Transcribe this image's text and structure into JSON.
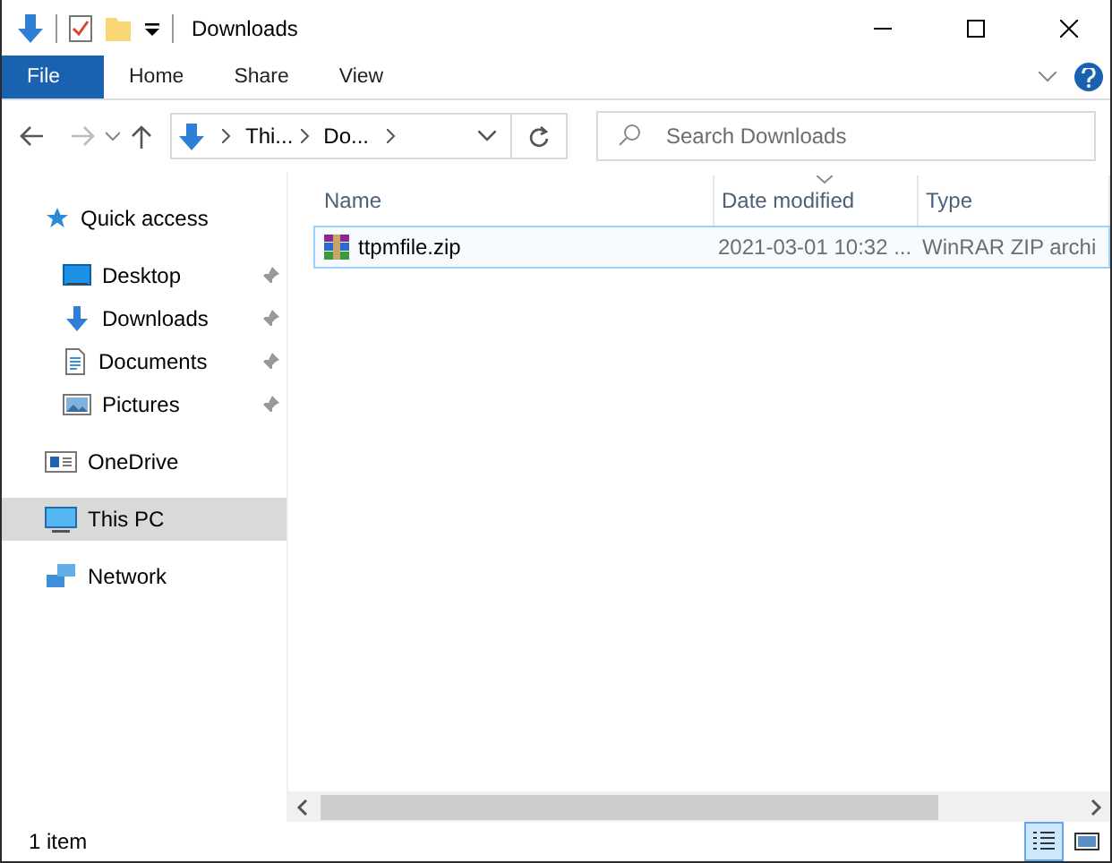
{
  "window": {
    "title": "Downloads"
  },
  "ribbon_tabs": [
    {
      "label": "File",
      "kind": "file",
      "selected": false
    },
    {
      "label": "Home",
      "kind": "tab",
      "selected": false
    },
    {
      "label": "Share",
      "kind": "tab",
      "selected": false
    },
    {
      "label": "View",
      "kind": "tab",
      "selected": false
    }
  ],
  "address": {
    "crumbs": [
      "Thi...",
      "Do..."
    ]
  },
  "search": {
    "placeholder": "Search Downloads"
  },
  "navigation": [
    {
      "label": "Quick access",
      "selected": false,
      "children": [
        {
          "label": "Desktop",
          "pinned": true,
          "selected": false
        },
        {
          "label": "Downloads",
          "pinned": true,
          "selected": false
        },
        {
          "label": "Documents",
          "pinned": true,
          "selected": false
        },
        {
          "label": "Pictures",
          "pinned": true,
          "selected": false
        }
      ]
    },
    {
      "label": "OneDrive",
      "selected": false
    },
    {
      "label": "This PC",
      "selected": true
    },
    {
      "label": "Network",
      "selected": false
    }
  ],
  "columns": [
    {
      "label": "Name",
      "sorted": false
    },
    {
      "label": "Date modified",
      "sorted": true
    },
    {
      "label": "Type",
      "sorted": false
    }
  ],
  "rows": [
    {
      "name": "ttpmfile.zip",
      "date": "2021-03-01 10:32 ...",
      "type": "WinRAR ZIP archi",
      "selected": true
    }
  ],
  "status_bar": {
    "text": "1 item",
    "views": [
      {
        "kind": "details",
        "selected": true
      },
      {
        "kind": "tiles",
        "selected": false
      }
    ]
  }
}
